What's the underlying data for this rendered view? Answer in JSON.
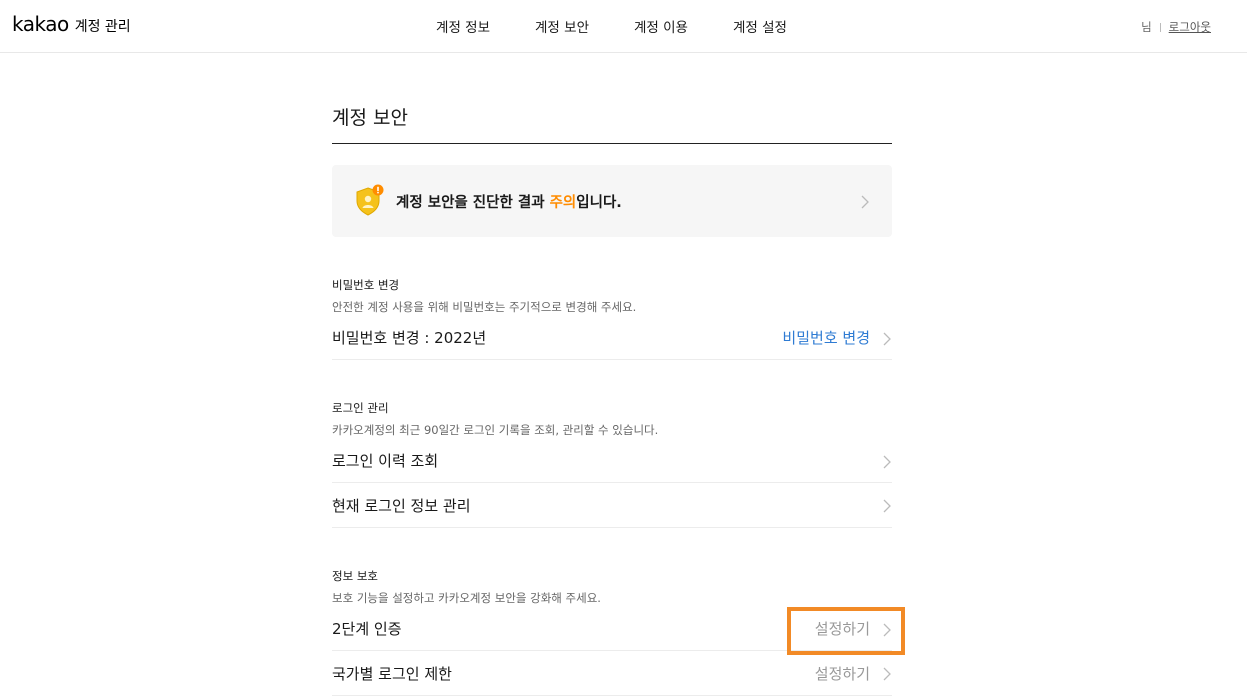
{
  "header": {
    "logo": "kakao",
    "app_name": "계정 관리",
    "nav": [
      "계정 정보",
      "계정 보안",
      "계정 이용",
      "계정 설정"
    ],
    "user_suffix": "님",
    "logout_label": "로그아웃"
  },
  "page": {
    "title": "계정 보안"
  },
  "diagnosis": {
    "text_before": "계정 보안을 진단한 결과 ",
    "status": "주의",
    "text_after": "입니다.",
    "status_color": "#ff8c00"
  },
  "password": {
    "title": "비밀번호 변경",
    "description": "안전한 계정 사용을 위해 비밀번호는 주기적으로 변경해 주세요.",
    "row_label": "비밀번호 변경 : 2022년",
    "action": "비밀번호 변경"
  },
  "login": {
    "title": "로그인 관리",
    "description": "카카오계정의 최근 90일간 로그인 기록을 조회, 관리할 수 있습니다.",
    "history_label": "로그인 이력 조회",
    "current_label": "현재 로그인 정보 관리"
  },
  "protection": {
    "title": "정보 보호",
    "description": "보호 기능을 설정하고 카카오계정 보안을 강화해 주세요.",
    "two_factor_label": "2단계 인증",
    "two_factor_action": "설정하기",
    "country_label": "국가별 로그인 제한",
    "country_action": "설정하기"
  },
  "colors": {
    "accent_blue": "#2e7bd3",
    "warning_orange": "#ff8c00",
    "highlight": "#f28a26"
  }
}
